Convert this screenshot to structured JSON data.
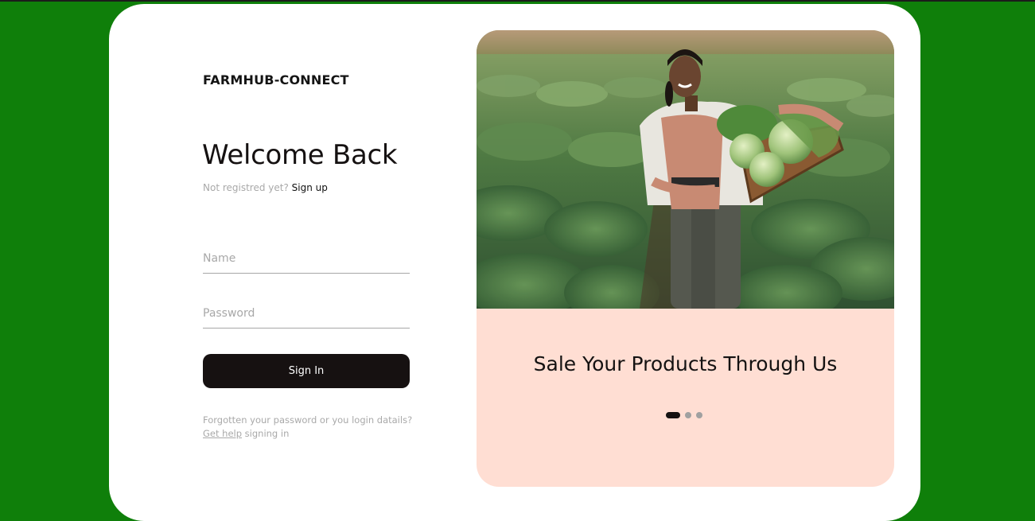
{
  "brand": {
    "name": "FARMHUB-CONNECT"
  },
  "login": {
    "heading": "Welcome Back",
    "not_registered": "Not registred yet?",
    "signup_link": "Sign up",
    "name_placeholder": "Name",
    "password_placeholder": "Password",
    "signin_label": "Sign In",
    "help_text_1": "Forgotten your password or you login datails?",
    "help_link": "Get help",
    "help_text_2": "signing in"
  },
  "promo": {
    "title": "Sale Your Products Through Us",
    "slides_total": 3,
    "active_slide": 1
  },
  "colors": {
    "page_background": "#0f7f0a",
    "card_background": "#ffffff",
    "promo_background": "#ffded3",
    "button_background": "#161111"
  }
}
